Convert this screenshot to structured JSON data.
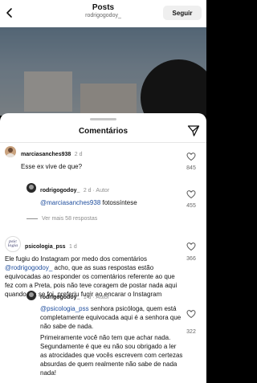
{
  "header": {
    "title": "Posts",
    "username": "rodrigogodoy_",
    "follow_label": "Seguir"
  },
  "sheet": {
    "title": "Comentários"
  },
  "comments": [
    {
      "user": "marciasanches938",
      "time": "2 d",
      "text": "Esse ex vive de que?",
      "likes": "845"
    },
    {
      "user": "rodrigogodoy_",
      "time": "2 d",
      "author_badge": "Autor",
      "mention": "@marciasanches938",
      "text": " fotossíntese",
      "likes": "455",
      "more_replies": "Ver mais 58 respostas"
    },
    {
      "user": "psicologia_pss",
      "time": "1 d",
      "line1": "Ele fugiu do Instagram por medo dos comentários",
      "mention": "@rodrigogodoy_",
      "rest": " acho, que as suas respostas estão equivocadas ao responder os comentários referente ao que fez com a Preta, pois não teve coragem de postar nada aqui quando ela se foi, preferiu fugir ao encarar o Instagram",
      "likes": "366",
      "avatar_text": "psic logia"
    },
    {
      "user": "rodrigogodoy_",
      "time": "1 d",
      "author_badge": "Autor",
      "mention": "@psicologia_pss",
      "text": " senhora psicóloga, quem está completamente equivocada aqui é a senhora que não sabe de nada.",
      "text2": "Primeiramente você não tem que achar nada. Segundamente é que eu não sou obrigado a ler as atrocidades que vocês escrevem com certezas absurdas de quem realmente não sabe de nada nada!",
      "likes": "322"
    }
  ],
  "colors": {
    "mention": "#1f4e9e",
    "meta": "#8e8e8e"
  }
}
